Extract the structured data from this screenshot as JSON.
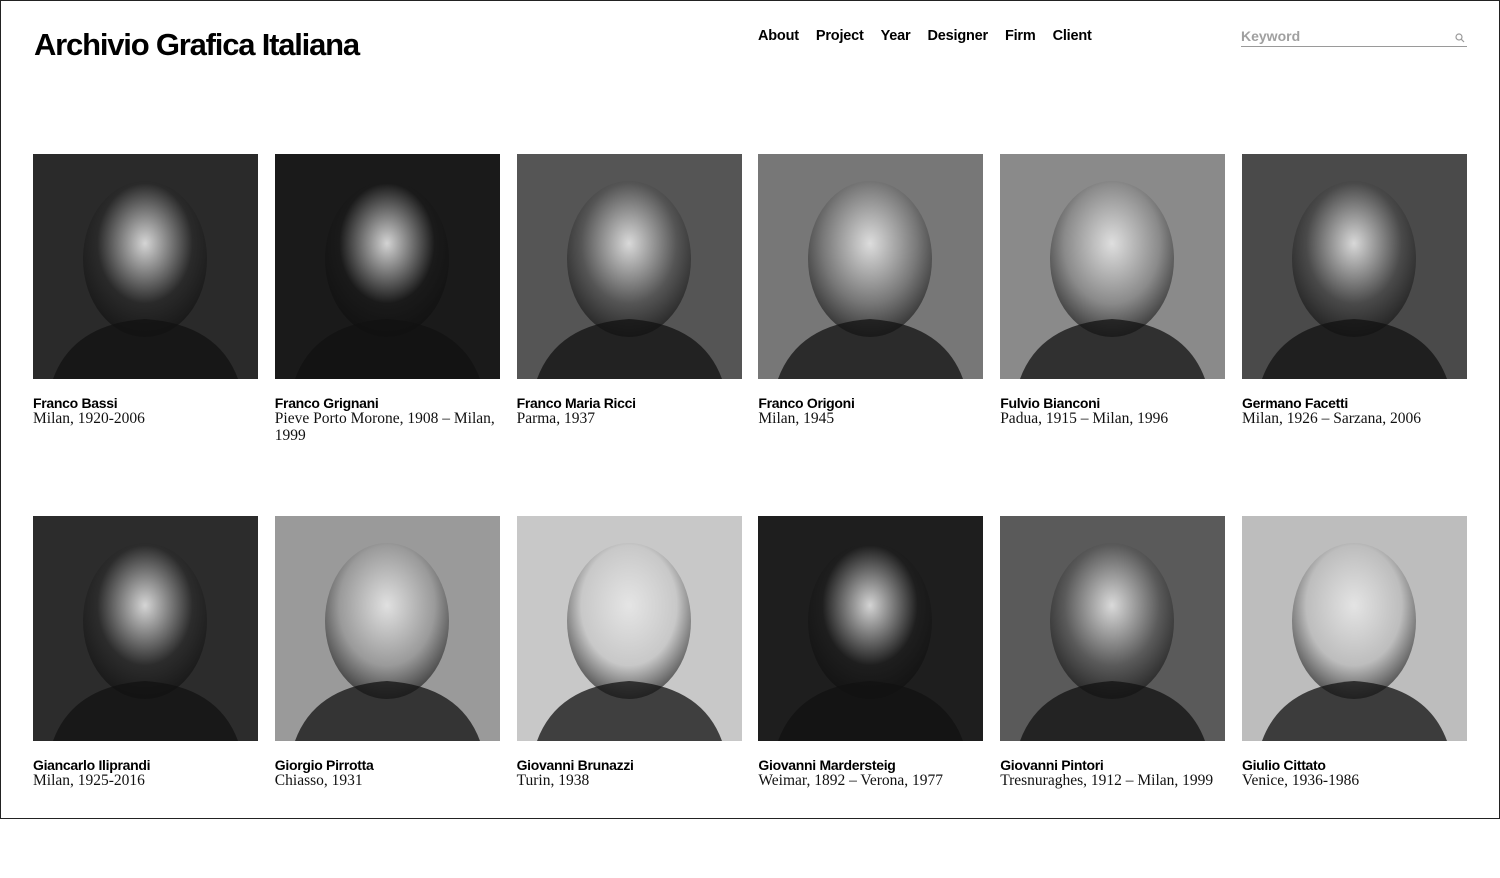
{
  "header": {
    "site_title": "Archivio Grafica Italiana",
    "nav": [
      "About",
      "Project",
      "Year",
      "Designer",
      "Firm",
      "Client"
    ],
    "search": {
      "placeholder": "Keyword",
      "icon": "search-icon"
    }
  },
  "designers": [
    {
      "name": "Franco Bassi",
      "bio": "Milan, 1920-2006",
      "photo_tone": "#2a2a2a"
    },
    {
      "name": "Franco Grignani",
      "bio": "Pieve Porto Morone, 1908 – Milan, 1999",
      "photo_tone": "#1a1a1a"
    },
    {
      "name": "Franco Maria Ricci",
      "bio": "Parma, 1937",
      "photo_tone": "#555555"
    },
    {
      "name": "Franco Origoni",
      "bio": "Milan, 1945",
      "photo_tone": "#777777"
    },
    {
      "name": "Fulvio Bianconi",
      "bio": "Padua, 1915 – Milan, 1996",
      "photo_tone": "#8a8a8a"
    },
    {
      "name": "Germano Facetti",
      "bio": "Milan, 1926 – Sarzana, 2006",
      "photo_tone": "#4a4a4a"
    },
    {
      "name": "Giancarlo Iliprandi",
      "bio": "Milan, 1925-2016",
      "photo_tone": "#2c2c2c"
    },
    {
      "name": "Giorgio Pirrotta",
      "bio": "Chiasso, 1931",
      "photo_tone": "#9a9a9a"
    },
    {
      "name": "Giovanni Brunazzi",
      "bio": "Turin, 1938",
      "photo_tone": "#c8c8c8"
    },
    {
      "name": "Giovanni Mardersteig",
      "bio": "Weimar, 1892 – Verona, 1977",
      "photo_tone": "#1e1e1e"
    },
    {
      "name": "Giovanni Pintori",
      "bio": "Tresnuraghes, 1912 – Milan, 1999",
      "photo_tone": "#5a5a5a"
    },
    {
      "name": "Giulio Cittato",
      "bio": "Venice, 1936-1986",
      "photo_tone": "#bdbdbd"
    }
  ]
}
